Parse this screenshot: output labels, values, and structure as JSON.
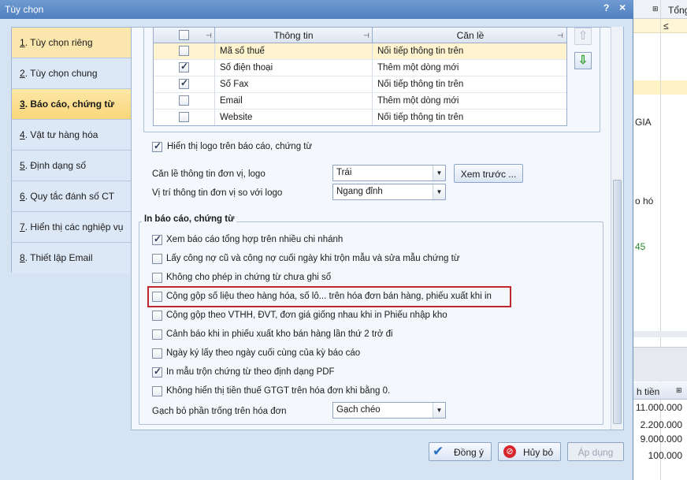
{
  "background_app": {
    "header_tong": "Tổng",
    "filter_symbol": "≤",
    "text_gia": "GIA",
    "text_oho": "o hó",
    "text_45": "45",
    "col_thanh_tien": "h tiền",
    "amounts": [
      "11.000.000",
      "2.200.000",
      "9.000.000",
      "100.000"
    ]
  },
  "dialog": {
    "title": "Tùy chọn",
    "help": "?",
    "close": "×"
  },
  "nav": {
    "items": [
      {
        "num": "1",
        "label": ". Tùy chọn riêng",
        "state": "hover"
      },
      {
        "num": "2",
        "label": ". Tùy chọn chung",
        "state": ""
      },
      {
        "num": "3",
        "label": ". Báo cáo, chứng từ",
        "state": "selected"
      },
      {
        "num": "4",
        "label": ". Vật tư hàng hóa",
        "state": ""
      },
      {
        "num": "5",
        "label": ". Định dạng số",
        "state": ""
      },
      {
        "num": "6",
        "label": ". Quy tắc đánh số CT",
        "state": ""
      },
      {
        "num": "7",
        "label": ". Hiển thị các nghiệp vụ",
        "state": ""
      },
      {
        "num": "8",
        "label": ". Thiết lập Email",
        "state": ""
      }
    ]
  },
  "grid": {
    "headers": {
      "info": "Thông tin",
      "align": "Căn lề"
    },
    "rows": [
      {
        "checked": false,
        "info": "Mã số thuế",
        "align": "Nối tiếp thông tin trên",
        "highlight": true
      },
      {
        "checked": true,
        "info": "Số điện thoại",
        "align": "Thêm một dòng mới",
        "highlight": false
      },
      {
        "checked": true,
        "info": "Số Fax",
        "align": "Nối tiếp thông tin trên",
        "highlight": false
      },
      {
        "checked": false,
        "info": "Email",
        "align": "Thêm một dòng mới",
        "highlight": false
      },
      {
        "checked": false,
        "info": "Website",
        "align": "Nối tiếp thông tin trên",
        "highlight": false
      }
    ]
  },
  "logo": {
    "show_logo_label": "Hiển thị logo trên báo cáo, chứng từ",
    "align_label": "Căn lề thông tin đơn vị, logo",
    "align_value": "Trái",
    "preview_button": "Xem trước ...",
    "position_label": "Vị trí thông tin đơn vị so với logo",
    "position_value": "Ngang đỉnh"
  },
  "print_group": {
    "title": "In báo cáo, chứng từ",
    "options": [
      {
        "checked": true,
        "label": "Xem báo cáo tổng hợp trên nhiều chi nhánh"
      },
      {
        "checked": false,
        "label": "Lấy công nợ cũ và công nợ cuối ngày khi trộn mẫu và sửa mẫu chứng từ"
      },
      {
        "checked": false,
        "label": "Không cho phép in chứng từ chưa ghi sổ"
      },
      {
        "checked": false,
        "label": "Cộng gộp số liệu theo hàng hóa, số lô... trên hóa đơn bán hàng, phiếu xuất khi in"
      },
      {
        "checked": false,
        "label": "Cộng gộp theo VTHH, ĐVT, đơn giá giống nhau khi in Phiếu nhập kho"
      },
      {
        "checked": false,
        "label": "Cảnh báo khi in phiếu xuất kho bán hàng lần thứ 2 trở đi"
      },
      {
        "checked": false,
        "label": "Ngày ký lấy theo ngày cuối cùng của kỳ báo cáo"
      },
      {
        "checked": true,
        "label": "In mẫu trộn chứng từ theo định dạng PDF"
      },
      {
        "checked": false,
        "label": "Không hiển thị tiền thuế GTGT trên hóa đơn khi bằng 0."
      }
    ],
    "strike_label": "Gạch bỏ phần trống trên hóa đơn",
    "strike_value": "Gạch chéo"
  },
  "footer": {
    "ok": "Đồng ý",
    "cancel": "Hủy bỏ",
    "apply": "Áp dụng"
  },
  "colors": {
    "highlight_box": "#c0272d",
    "selected_nav": "#f9d679"
  }
}
